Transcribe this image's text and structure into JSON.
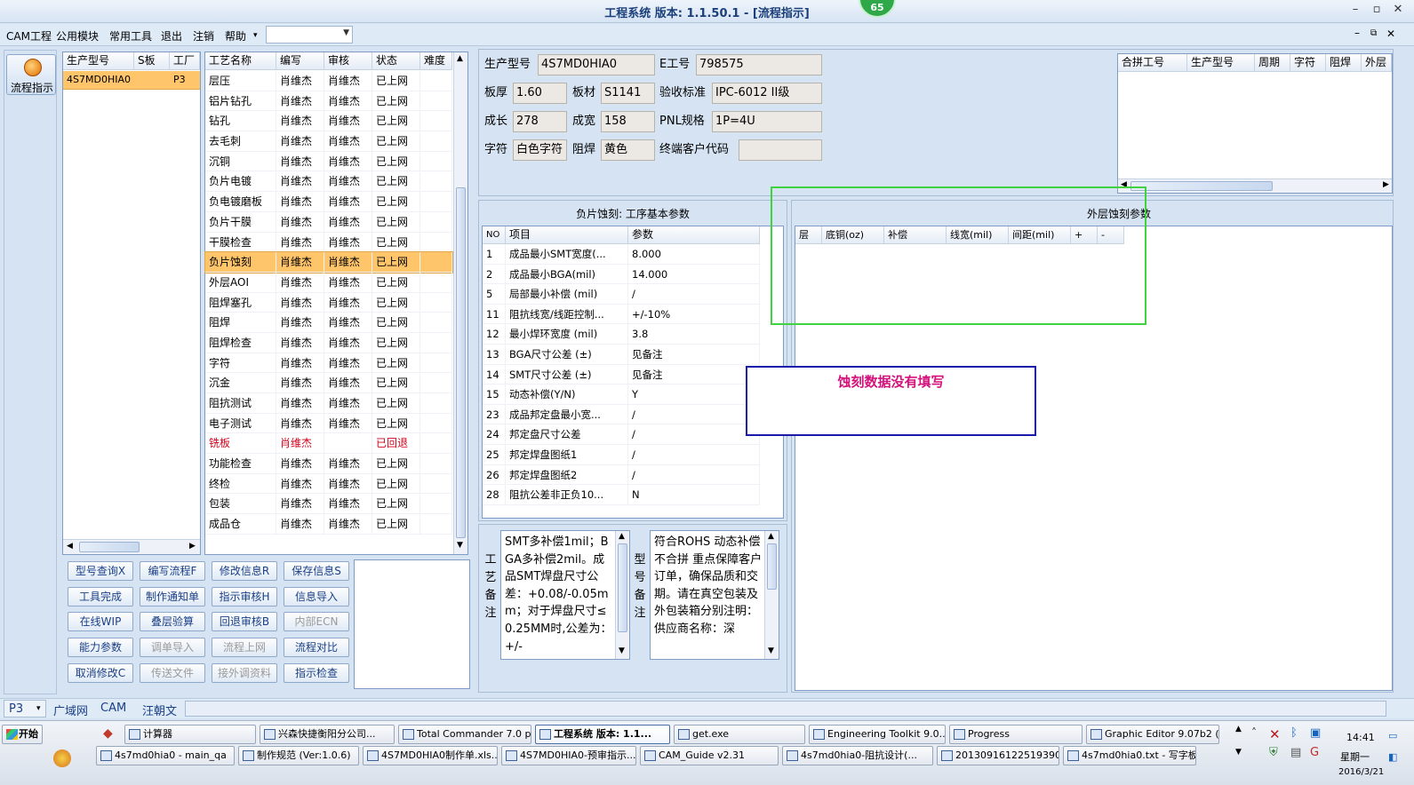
{
  "window": {
    "title": "工程系统  版本: 1.1.50.1 - [流程指示]",
    "badge": "65"
  },
  "menu": {
    "items": [
      "CAM工程",
      "公用模块",
      "常用工具",
      "退出",
      "注销",
      "帮助"
    ],
    "combo_value": ""
  },
  "left": {
    "flow_label": "流程指示"
  },
  "model_list": {
    "headers": [
      "生产型号",
      "S板",
      "工厂"
    ],
    "rows": [
      [
        "4S7MD0HIA0",
        "",
        "P3"
      ]
    ]
  },
  "process_table": {
    "headers": [
      "工艺名称",
      "编写",
      "审核",
      "状态",
      "难度"
    ],
    "rows": [
      [
        "层压",
        "肖维杰",
        "肖维杰",
        "已上网"
      ],
      [
        "铝片钻孔",
        "肖维杰",
        "肖维杰",
        "已上网"
      ],
      [
        "钻孔",
        "肖维杰",
        "肖维杰",
        "已上网"
      ],
      [
        "去毛刺",
        "肖维杰",
        "肖维杰",
        "已上网"
      ],
      [
        "沉铜",
        "肖维杰",
        "肖维杰",
        "已上网"
      ],
      [
        "负片电镀",
        "肖维杰",
        "肖维杰",
        "已上网"
      ],
      [
        "负电镀磨板",
        "肖维杰",
        "肖维杰",
        "已上网"
      ],
      [
        "负片干膜",
        "肖维杰",
        "肖维杰",
        "已上网"
      ],
      [
        "干膜检查",
        "肖维杰",
        "肖维杰",
        "已上网"
      ],
      [
        "负片蚀刻",
        "肖维杰",
        "肖维杰",
        "已上网"
      ],
      [
        "外层AOI",
        "肖维杰",
        "肖维杰",
        "已上网"
      ],
      [
        "阻焊塞孔",
        "肖维杰",
        "肖维杰",
        "已上网"
      ],
      [
        "阻焊",
        "肖维杰",
        "肖维杰",
        "已上网"
      ],
      [
        "阻焊检查",
        "肖维杰",
        "肖维杰",
        "已上网"
      ],
      [
        "字符",
        "肖维杰",
        "肖维杰",
        "已上网"
      ],
      [
        "沉金",
        "肖维杰",
        "肖维杰",
        "已上网"
      ],
      [
        "阻抗测试",
        "肖维杰",
        "肖维杰",
        "已上网"
      ],
      [
        "电子测试",
        "肖维杰",
        "肖维杰",
        "已上网"
      ],
      [
        "铣板",
        "肖维杰",
        "",
        "已回退"
      ],
      [
        "功能检查",
        "肖维杰",
        "肖维杰",
        "已上网"
      ],
      [
        "终检",
        "肖维杰",
        "肖维杰",
        "已上网"
      ],
      [
        "包装",
        "肖维杰",
        "肖维杰",
        "已上网"
      ],
      [
        "成品仓",
        "肖维杰",
        "肖维杰",
        "已上网"
      ]
    ],
    "selected_index": 9,
    "returned_index": 18,
    "returned_color": "#d0021b",
    "selected_color": "#ffc56b"
  },
  "buttons": [
    [
      "型号查询X",
      "编写流程F",
      "修改信息R",
      "保存信息S"
    ],
    [
      "工具完成",
      "制作通知单",
      "指示审核H",
      "信息导入"
    ],
    [
      "在线WIP",
      "叠层验算",
      "回退审核B",
      "内部ECN"
    ],
    [
      "能力参数",
      "调单导入",
      "流程上网",
      "流程对比"
    ],
    [
      "取消修改C",
      "传送文件",
      "接外调资料",
      "指示检查"
    ]
  ],
  "disabled_buttons": [
    "内部ECN",
    "调单导入",
    "流程上网",
    "传送文件",
    "接外调资料"
  ],
  "info": {
    "prod_model_label": "生产型号",
    "prod_model": "4S7MD0HIA0",
    "e_no_label": "E工号",
    "e_no": "798575",
    "thickness_label": "板厚",
    "thickness": "1.60",
    "material_label": "板材",
    "material": "S1141",
    "standard_label": "验收标准",
    "standard": "IPC-6012 II级",
    "length_label": "成长",
    "length": "278",
    "width_label": "成宽",
    "width": "158",
    "pnl_label": "PNL规格",
    "pnl": "1P=4U",
    "char_label": "字符",
    "char": "白色字符",
    "mask_label": "阻焊",
    "mask": "黄色",
    "customer_label": "终端客户代码",
    "customer": ""
  },
  "combine_table": {
    "headers": [
      "合拼工号",
      "生产型号",
      "周期",
      "字符",
      "阻焊",
      "外层"
    ]
  },
  "basic_params": {
    "title": "负片蚀刻: 工序基本参数",
    "headers": [
      "NO",
      "项目",
      "参数"
    ],
    "rows": [
      [
        "1",
        "成品最小SMT宽度(...",
        "8.000"
      ],
      [
        "2",
        "成品最小BGA(mil)",
        "14.000"
      ],
      [
        "5",
        "局部最小补偿 (mil)",
        "/"
      ],
      [
        "11",
        "阻抗线宽/线距控制...",
        "+/-10%"
      ],
      [
        "12",
        "最小焊环宽度 (mil)",
        "3.8"
      ],
      [
        "13",
        "BGA尺寸公差 (±)",
        "见备注"
      ],
      [
        "14",
        "SMT尺寸公差 (±)",
        "见备注"
      ],
      [
        "15",
        "动态补偿(Y/N)",
        "Y"
      ],
      [
        "23",
        "成品邦定盘最小宽...",
        "/"
      ],
      [
        "24",
        "邦定盘尺寸公差",
        "/"
      ],
      [
        "25",
        "邦定焊盘图纸1",
        "/"
      ],
      [
        "26",
        "邦定焊盘图纸2",
        "/"
      ],
      [
        "28",
        "阻抗公差非正负10...",
        "N"
      ]
    ]
  },
  "etch_params": {
    "title": "外层蚀刻参数",
    "headers": [
      "层",
      "底铜(oz)",
      "补偿",
      "线宽(mil)",
      "间距(mil)",
      "+",
      "-"
    ]
  },
  "annotation": {
    "text": "蚀刻数据没有填写",
    "text_color": "#d4117a",
    "box_color": "#1a1aaa",
    "highlight_color": "#3fd43f"
  },
  "remarks": {
    "process_label": "工艺备注",
    "process_text": "SMT多补偿1mil；BGA多补偿2mil。成品SMT焊盘尺寸公差：+0.08/-0.05mm；对于焊盘尺寸≤0.25MM时,公差为：+/-",
    "model_label": "型号备注",
    "model_text": "符合ROHS 动态补偿不合拼 重点保障客户订单，确保品质和交期。请在真空包装及外包装箱分别注明：供应商名称：深"
  },
  "status": {
    "combo": "P3",
    "tabs": [
      "广域网",
      "CAM",
      "汪朝文"
    ]
  },
  "taskbar": {
    "start": "开始",
    "row1": [
      "计算器",
      "兴森快捷衡阳分公司...",
      "Total Commander 7.0 p...",
      "工程系统  版本: 1.1...",
      "get.exe",
      "Engineering Toolkit 9.0...",
      "Progress",
      "Graphic Editor 9.07b2 (..."
    ],
    "row2": [
      "4s7md0hia0 - main_qa",
      "制作规范 (Ver:1.0.6)",
      "4S7MD0HIA0制作单.xls...",
      "4S7MD0HIA0-预审指示...",
      "CAM_Guide v2.31",
      "4s7md0hia0-阻抗设计(...",
      "20130916122519390.rtf...",
      "4s7md0hia0.txt - 写字板"
    ],
    "time": "14:41",
    "weekday": "星期一",
    "date": "2016/3/21"
  }
}
